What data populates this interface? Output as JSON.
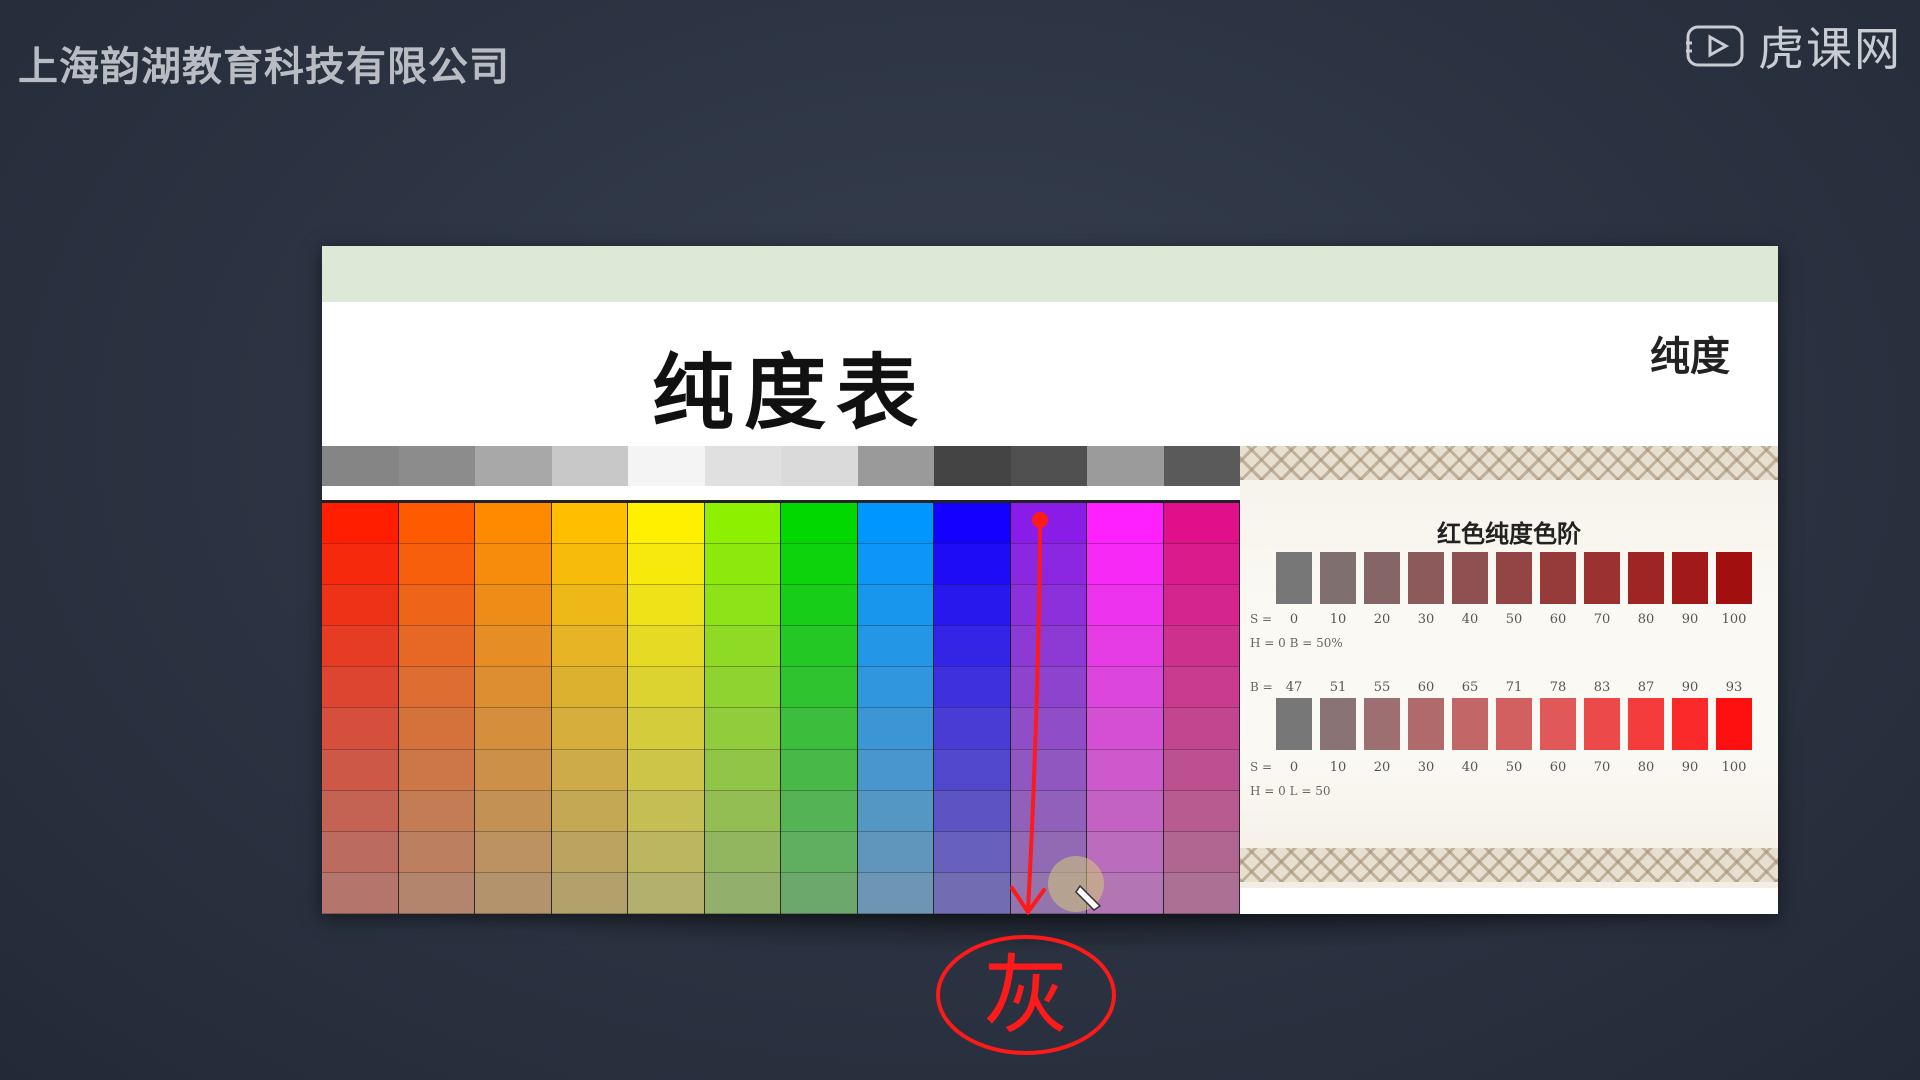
{
  "header": {
    "company": "上海韵湖教育科技有限公司",
    "brand": "虎课网"
  },
  "slide": {
    "title": "纯度表",
    "label": "纯度",
    "gray_row": [
      "#858585",
      "#8c8c8c",
      "#a8a8a8",
      "#c8c8c8",
      "#f4f4f4",
      "#e0e0e0",
      "#dadada",
      "#9a9a9a",
      "#444444",
      "#505050",
      "#9b9b9b",
      "#5a5a5a"
    ],
    "hues": [
      "#ff1f00",
      "#ff5a00",
      "#ff8a00",
      "#ffbe00",
      "#fff000",
      "#8cf000",
      "#00d800",
      "#0096ff",
      "#1400ff",
      "#8a1ce8",
      "#ff20ff",
      "#e0108a"
    ],
    "panel": {
      "title": "红色纯度色阶",
      "scale_values": [
        "0",
        "10",
        "20",
        "30",
        "40",
        "50",
        "60",
        "70",
        "80",
        "90",
        "100"
      ],
      "b_values": [
        "47",
        "51",
        "55",
        "60",
        "65",
        "71",
        "78",
        "83",
        "87",
        "90",
        "93"
      ],
      "s_label": "S =",
      "hb_label": "H = 0 B = 50%",
      "b_label": "B =",
      "hl_label": "H = 0 L = 50",
      "swatches_row1": [
        "#777777",
        "#7f6f6f",
        "#866566",
        "#8c5a5b",
        "#8f5051",
        "#934545",
        "#963b3a",
        "#9b3131",
        "#9f2525",
        "#a11a19",
        "#a20f0f"
      ],
      "swatches_row2": [
        "#777777",
        "#8a7374",
        "#9e6f70",
        "#b06a6b",
        "#c26667",
        "#d26061",
        "#e15858",
        "#ec4a4a",
        "#f43c3c",
        "#fa2a2a",
        "#ff1010"
      ]
    }
  },
  "annotation": {
    "text": "灰",
    "color": "#ff1a1a"
  }
}
